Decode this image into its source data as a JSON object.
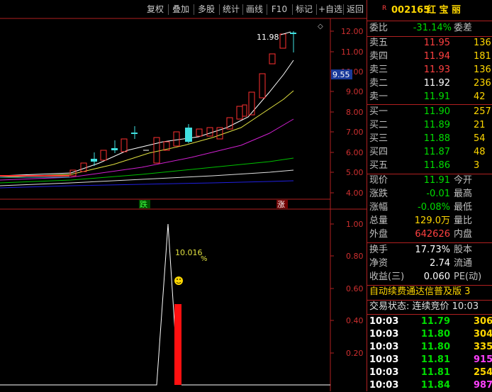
{
  "toolbar": {
    "buttons": [
      "复权",
      "叠加",
      "多股",
      "统计",
      "画线",
      "F10",
      "标记",
      "+自选",
      "返回"
    ]
  },
  "main_chart": {
    "peak_label": "11.98",
    "price_marker": "9.55",
    "y_ticks": [
      "12.00",
      "11.00",
      "10.00",
      "9.00",
      "8.00",
      "7.00",
      "6.00",
      "5.00",
      "4.00"
    ],
    "marker_left": "跌",
    "marker_right": "涨"
  },
  "sub_chart": {
    "y_ticks": [
      "1.00",
      "0.80",
      "0.60",
      "0.40",
      "0.20"
    ],
    "annotation": "10.016",
    "annotation_unit": "%"
  },
  "quote": {
    "badge": "R",
    "code": "002165",
    "name": "红 宝 丽",
    "wei_bi_label": "委比",
    "wei_bi_value": "-31.14%",
    "wei_cha_label": "委差",
    "asks": [
      {
        "label": "卖五",
        "price": "11.95",
        "vol": "136"
      },
      {
        "label": "卖四",
        "price": "11.94",
        "vol": "181"
      },
      {
        "label": "卖三",
        "price": "11.93",
        "vol": "136"
      },
      {
        "label": "卖二",
        "price": "11.92",
        "vol": "236"
      },
      {
        "label": "卖一",
        "price": "11.91",
        "vol": "42"
      }
    ],
    "bids": [
      {
        "label": "买一",
        "price": "11.90",
        "vol": "257"
      },
      {
        "label": "买二",
        "price": "11.89",
        "vol": "21"
      },
      {
        "label": "买三",
        "price": "11.88",
        "vol": "54"
      },
      {
        "label": "买四",
        "price": "11.87",
        "vol": "48"
      },
      {
        "label": "买五",
        "price": "11.86",
        "vol": "3"
      }
    ],
    "stats": [
      {
        "label": "现价",
        "value": "11.91",
        "label2": "今开"
      },
      {
        "label": "涨跌",
        "value": "-0.01",
        "label2": "最高"
      },
      {
        "label": "涨幅",
        "value": "-0.08%",
        "label2": "最低"
      },
      {
        "label": "总量",
        "value": "129.0万",
        "label2": "量比"
      },
      {
        "label": "外盘",
        "value": "642626",
        "label2": "内盘"
      }
    ],
    "stats2": [
      {
        "label": "换手",
        "value": "17.73%",
        "label2": "股本"
      },
      {
        "label": "净资",
        "value": "2.74",
        "label2": "流通"
      },
      {
        "label": "收益(三)",
        "value": "0.060",
        "label2": "PE(动)"
      }
    ],
    "tags": "自动续费通达信普及版 3",
    "status": "交易状态: 连续竞价 10:03",
    "ticks": [
      {
        "time": "10:03",
        "price": "11.79",
        "vol": "306"
      },
      {
        "time": "10:03",
        "price": "11.80",
        "vol": "304"
      },
      {
        "time": "10:03",
        "price": "11.80",
        "vol": "335"
      },
      {
        "time": "10:03",
        "price": "11.81",
        "vol": "915"
      },
      {
        "time": "10:03",
        "price": "11.81",
        "vol": "254"
      },
      {
        "time": "10:03",
        "price": "11.84",
        "vol": "987"
      }
    ]
  },
  "colors": {
    "up": "#ff4040",
    "down": "#00dd00",
    "frame": "#b02020",
    "bg": "#000000"
  }
}
